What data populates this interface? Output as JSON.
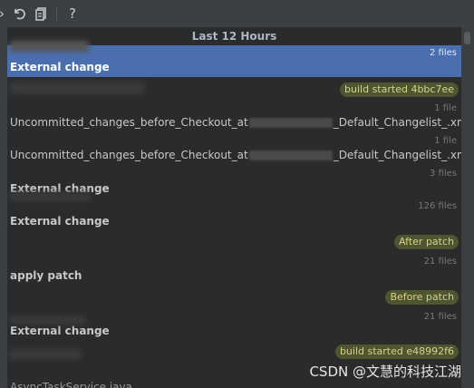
{
  "toolbar": {
    "undo_icon": "undo-icon",
    "copy_icon": "copy-icon",
    "help_label": "?"
  },
  "history": {
    "group_header": "Last 12 Hours",
    "entries": [
      {
        "count": "2 files",
        "title": "External change",
        "selected": true
      },
      {
        "tag": "build started 4bbc7ee"
      },
      {
        "count": "1 file",
        "title_prefix": "Uncommitted_changes_before_Checkout_at",
        "title_suffix": "_Default_Changelist_.xml"
      },
      {
        "count": "1 file",
        "title_prefix": "Uncommitted_changes_before_Checkout_at",
        "title_suffix": "_Default_Changelist_.xml"
      },
      {
        "count": "3 files",
        "title": "External change"
      },
      {
        "count": "126 files",
        "title": "External change"
      },
      {
        "tag": "After patch"
      },
      {
        "count": "21 files",
        "title": "apply patch"
      },
      {
        "tag": "Before patch"
      },
      {
        "count": "21 files",
        "title": "External change"
      },
      {
        "tag": "build started e48992f6"
      },
      {
        "title": "AsyncTaskService.java"
      }
    ]
  },
  "watermark": "CSDN @文慧的科技江湖",
  "colors": {
    "selection": "#4b6eaf",
    "tag_bg": "#4e5530",
    "tag_text": "#d6d28a"
  }
}
